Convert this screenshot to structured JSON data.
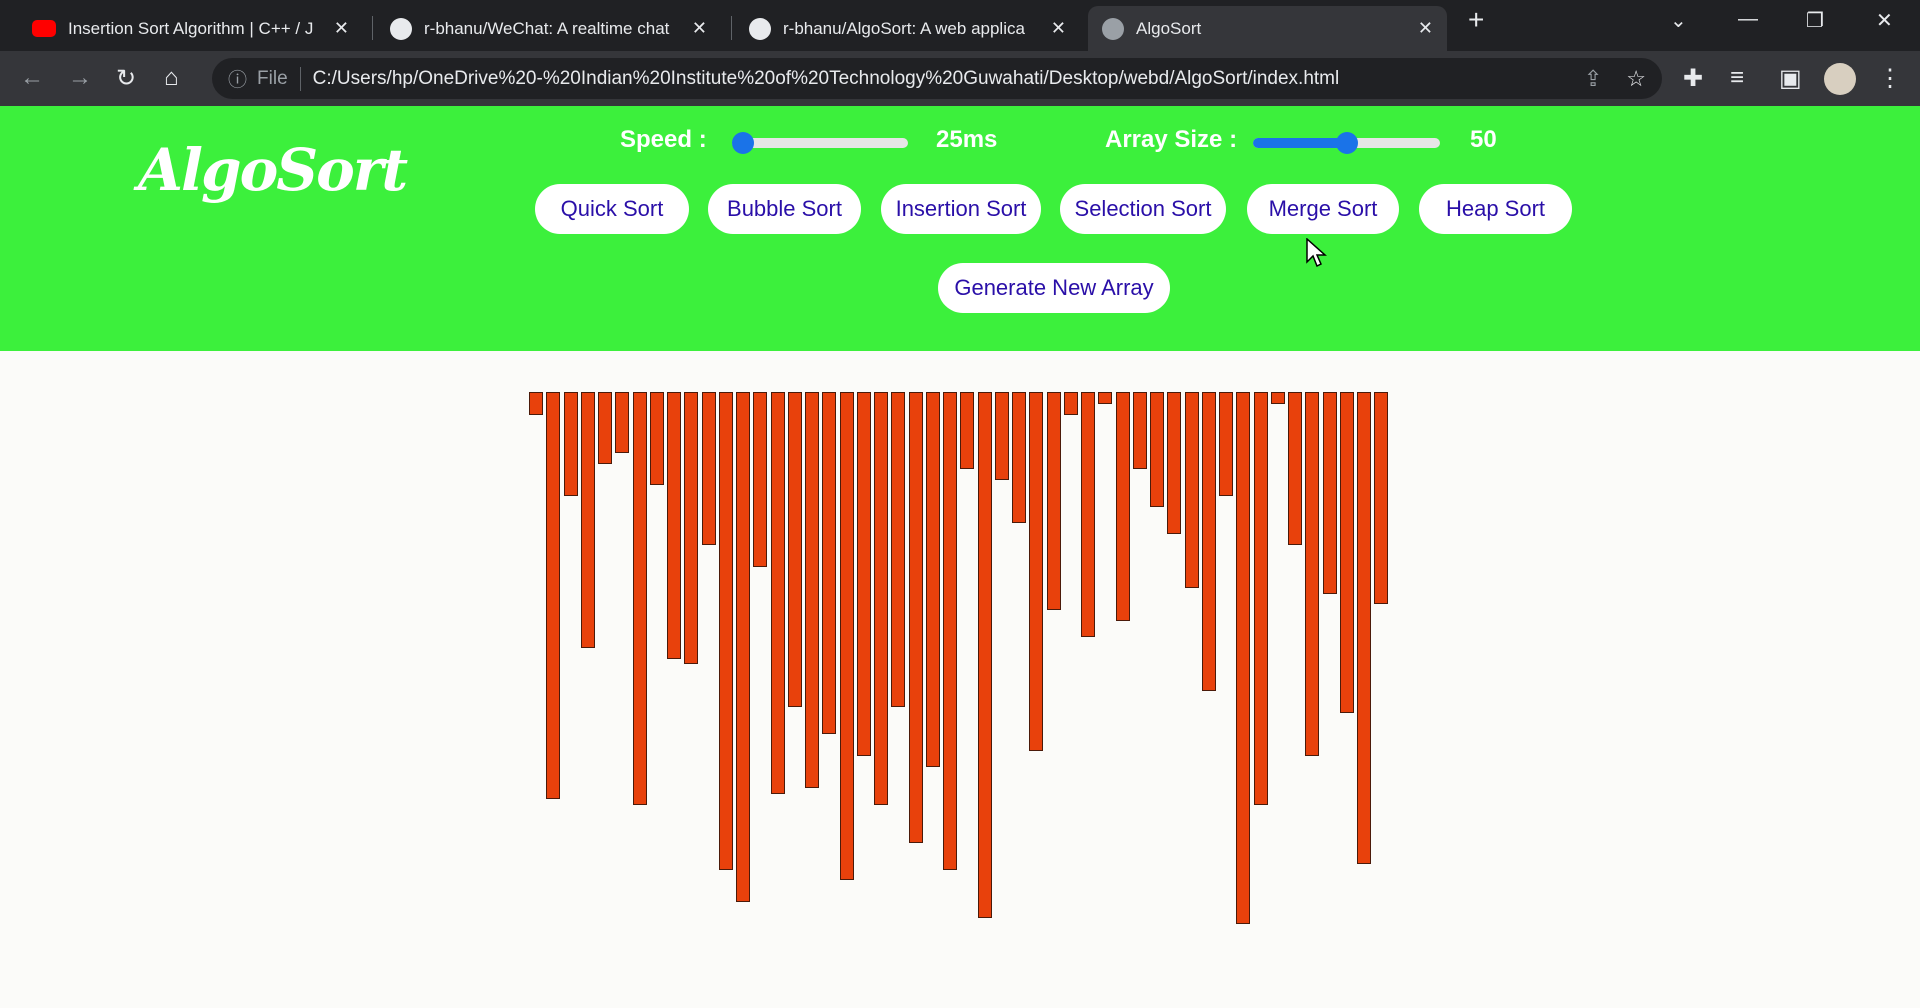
{
  "browser": {
    "tabs": [
      {
        "title": "Insertion Sort Algorithm | C++ / J",
        "icon": "youtube-icon"
      },
      {
        "title": "r-bhanu/WeChat: A realtime chat",
        "icon": "github-icon"
      },
      {
        "title": "r-bhanu/AlgoSort: A web applica",
        "icon": "github-icon"
      },
      {
        "title": "AlgoSort",
        "icon": "globe-icon"
      }
    ],
    "new_tab": "+",
    "address_scheme": "File",
    "url": "C:/Users/hp/OneDrive%20-%20Indian%20Institute%20of%20Technology%20Guwahati/Desktop/webd/AlgoSort/index.html"
  },
  "header": {
    "logo": "AlgoSort",
    "speed_label": "Speed :",
    "speed_value": "25ms",
    "speed_fraction": 0.0,
    "size_label": "Array Size :",
    "size_value": "50",
    "size_fraction": 0.5,
    "buttons": [
      "Quick Sort",
      "Bubble Sort",
      "Insertion Sort",
      "Selection Sort",
      "Merge Sort",
      "Heap Sort"
    ],
    "generate": "Generate New Array"
  },
  "array": {
    "bar_color": "#e8410c",
    "values": [
      23,
      407,
      104,
      256,
      72,
      61,
      413,
      93,
      267,
      272,
      153,
      478,
      510,
      175,
      402,
      315,
      396,
      342,
      488,
      364,
      413,
      315,
      451,
      375,
      478,
      77,
      526,
      88,
      131,
      359,
      218,
      23,
      245,
      12,
      229,
      77,
      115,
      142,
      196,
      299,
      104,
      532,
      413,
      12,
      153,
      364,
      202,
      321,
      472,
      212
    ]
  }
}
